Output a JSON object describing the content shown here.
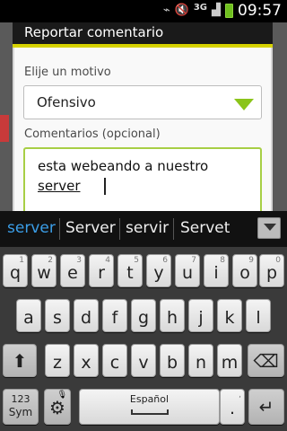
{
  "status": {
    "network": "3G",
    "time": "09:57",
    "icons": [
      "usb-icon",
      "mute-icon",
      "signal-icon",
      "battery-icon"
    ]
  },
  "dialog": {
    "title": "Reportar comentario",
    "motivo_label": "Elije un motivo",
    "motivo_value": "Ofensivo",
    "comentarios_label": "Comentarios (opcional)",
    "comentario_line1": "esta webeando a nuestro",
    "comentario_line2": "server"
  },
  "suggestions": [
    "server",
    "Server",
    "servir",
    "Servet"
  ],
  "keyboard": {
    "row1": [
      [
        "q",
        "1"
      ],
      [
        "w",
        "2"
      ],
      [
        "e",
        "3"
      ],
      [
        "r",
        "4"
      ],
      [
        "t",
        "5"
      ],
      [
        "y",
        "6"
      ],
      [
        "u",
        "7"
      ],
      [
        "i",
        "8"
      ],
      [
        "o",
        "9"
      ],
      [
        "p",
        "0"
      ]
    ],
    "row2": [
      "a",
      "s",
      "d",
      "f",
      "g",
      "h",
      "j",
      "k",
      "l"
    ],
    "row3": [
      "z",
      "x",
      "c",
      "v",
      "b",
      "n",
      "m"
    ],
    "sym_line1": "123",
    "sym_line2": "Sym",
    "space_label": "Español",
    "period": "."
  },
  "colors": {
    "accent": "#a7cf45",
    "suggestion_primary": "#3b9ee8",
    "title_bar_underline": "#d6d200"
  }
}
